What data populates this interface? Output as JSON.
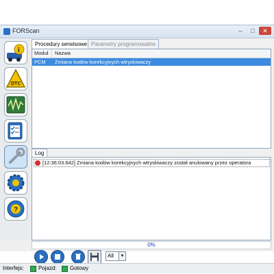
{
  "window": {
    "title": "FORScan"
  },
  "tabs": [
    {
      "label": "Procedury serwisowe",
      "active": true
    },
    {
      "label": "Parametry programowalne",
      "active": false
    }
  ],
  "table": {
    "columns": [
      "Moduł",
      "Nazwa"
    ],
    "rows": [
      {
        "module": "PCM",
        "name": "Zmiana kodów korekcyjnych wtryskiwaczy",
        "selected": true
      }
    ]
  },
  "log": {
    "tab_label": "Log",
    "entries": [
      {
        "level": "error",
        "text": "[12:36:03.642] Zmiana kodów korekcyjnych wtryskiwaczy został anulowany przez operatora"
      }
    ]
  },
  "progress": {
    "label": "0%",
    "value": 0
  },
  "toolbar": {
    "select_value": "All"
  },
  "sidebar": {
    "items": [
      {
        "name": "vehicle-info-icon"
      },
      {
        "name": "dtc-icon"
      },
      {
        "name": "oscilloscope-icon"
      },
      {
        "name": "tests-checklist-icon"
      },
      {
        "name": "service-wrench-icon",
        "active": true
      },
      {
        "name": "configuration-gear-icon"
      },
      {
        "name": "help-icon"
      }
    ]
  },
  "status": {
    "interface_label": "Interfejs:",
    "vehicle_label": "Pojazd:",
    "ready_label": "Gotowy",
    "ok_color": "#2fa84f"
  },
  "colors": {
    "selection": "#3c8be0",
    "progress_text": "#1a3cc7",
    "error": "#d9302a"
  }
}
